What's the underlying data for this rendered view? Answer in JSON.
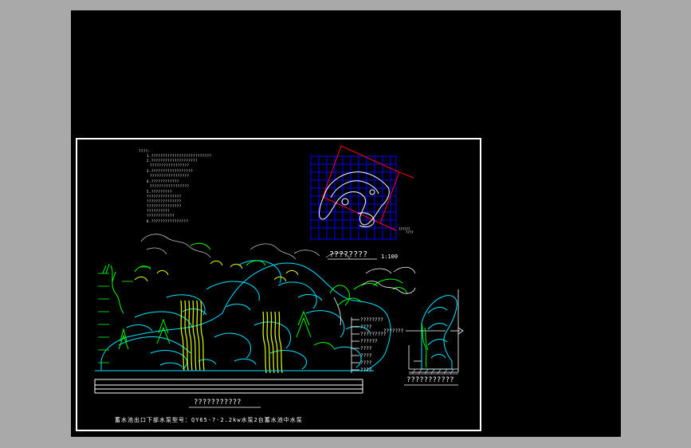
{
  "scale_label": "1:100",
  "grid_label_left": "??????",
  "grid_label_right": "????",
  "plan_title": "????????",
  "elevation_title": "???????????",
  "section_title": "???????????",
  "bottom_note": "蓄水池出口下部水泵型号：QY65-7-2.2kw水泵2台蓄水池中水泵",
  "notes": [
    "????:",
    "1.??????????????????????????",
    "2.????????????????????",
    "  ?????????????????",
    "3.??????????????????",
    "  ?????????????????",
    "4.????????????",
    "  ?????????????????",
    "5.?????????",
    "           ???????????????",
    "           ???????????????",
    "           ???????????????",
    "           ??????????",
    "           ????????????",
    "6.????????????????"
  ],
  "legend_labels": [
    "????????",
    "????",
    "?????????",
    "??????",
    "????",
    "????",
    "????",
    "????"
  ],
  "side_label": "???????",
  "colors": {
    "background": "#000000",
    "grid": "#0000ff",
    "rock": "#00e5ff",
    "plant": "#00ff00",
    "waterfall": "#e5ff00",
    "annotation": "#ffffff",
    "red": "#ff0000"
  }
}
